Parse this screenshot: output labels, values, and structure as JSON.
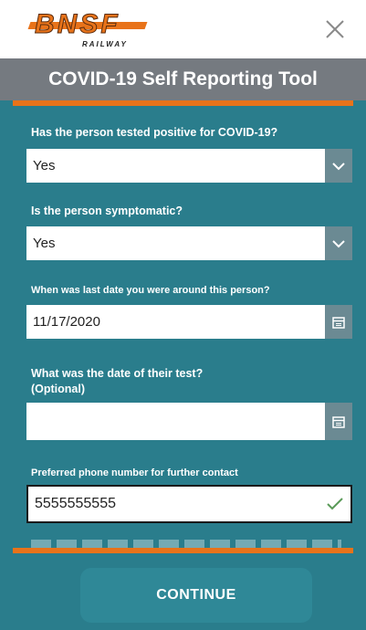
{
  "header": {
    "logo_text": "BNSF",
    "logo_subtext": "RAILWAY"
  },
  "title": "COVID-19 Self Reporting Tool",
  "questions": [
    {
      "label": "Has the person tested positive for COVID-19?",
      "value": "Yes"
    },
    {
      "label": "Is the person symptomatic?",
      "value": "Yes"
    },
    {
      "label": "When was last date you were around this person?",
      "value": "11/17/2020"
    },
    {
      "label": "What was the date of their test? (Optional)",
      "value": ""
    },
    {
      "label": "Preferred phone number for further contact",
      "value": "5555555555"
    }
  ],
  "continue_label": "CONTINUE",
  "colors": {
    "brand_orange": "#e8731a",
    "background_teal": "#2a7d8c",
    "titlebar_gray": "#757a80",
    "check_green": "#5a9a58"
  }
}
